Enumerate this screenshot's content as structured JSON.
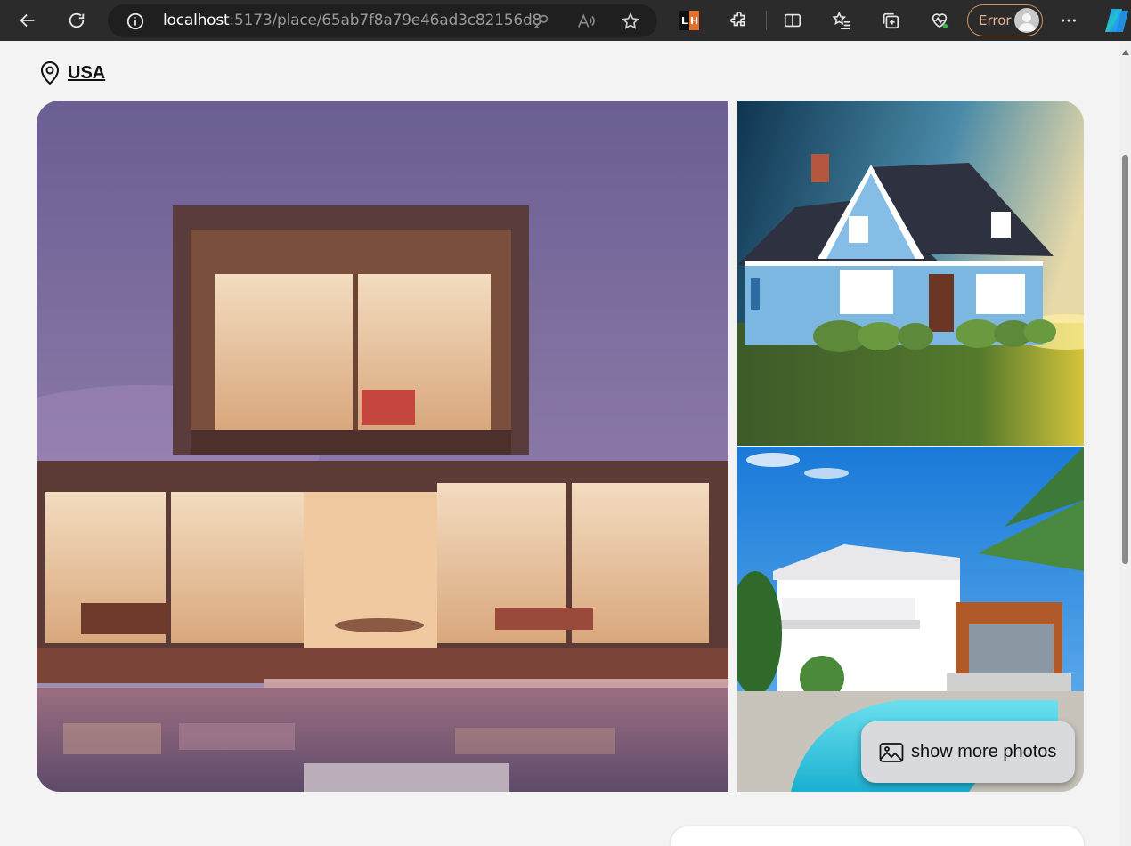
{
  "browser": {
    "url_host": "localhost",
    "url_rest": ":5173/place/65ab7f8a79e46ad3c82156d8",
    "profile_status": "Error",
    "extension_badge": [
      "L",
      "H"
    ]
  },
  "place": {
    "location_label": "USA",
    "photos": [
      {
        "name": "modern-house-pool-photo"
      },
      {
        "name": "blue-cottage-photo"
      },
      {
        "name": "white-house-pool-photo"
      }
    ],
    "show_more_label": "show more photos"
  },
  "icons": {
    "back": "back-arrow-icon",
    "refresh": "refresh-icon",
    "info": "site-info-icon",
    "key": "password-key-icon",
    "read_aloud": "read-aloud-icon",
    "favorite": "favorite-star-icon",
    "extensions": "extensions-puzzle-icon",
    "split": "split-screen-icon",
    "favorites": "favorites-list-icon",
    "collections": "collections-icon",
    "health": "browser-essentials-icon",
    "menu": "more-menu-icon",
    "copilot": "copilot-icon",
    "location": "map-pin-icon",
    "photos": "photos-icon"
  },
  "colors": {
    "chrome": "#2b2b2b",
    "address_bar": "#1f1f1f",
    "page_bg": "#f3f3f4",
    "button_bg": "#d9dade",
    "error_accent": "#d4925a"
  }
}
